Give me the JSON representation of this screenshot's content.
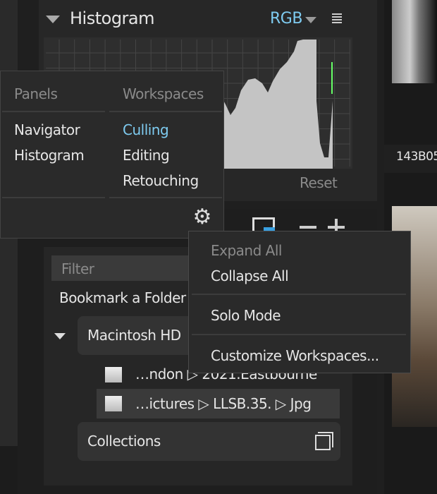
{
  "histogram": {
    "title": "Histogram",
    "channel": "RGB",
    "reset_label": "Reset",
    "icons": {
      "collapse": "triangle-down-icon",
      "dropdown": "caret-down-icon",
      "menu": "hamburger-icon"
    }
  },
  "panels_popup": {
    "panels_header": "Panels",
    "workspaces_header": "Workspaces",
    "panels": [
      {
        "label": "Navigator"
      },
      {
        "label": "Histogram"
      }
    ],
    "workspaces": [
      {
        "label": "Culling",
        "active": true
      },
      {
        "label": "Editing"
      },
      {
        "label": "Retouching"
      }
    ],
    "settings_icon": "gear-icon"
  },
  "folders": {
    "filter_placeholder": "Filter",
    "bookmark_label": "Bookmark a Folder",
    "drive_label": "Macintosh HD",
    "items": [
      {
        "label": "…ndon ▷ 2021.Eastbourne"
      },
      {
        "label": "…ictures ▷ LLSB.35. ▷ Jpg",
        "selected": true
      }
    ],
    "collections_label": "Collections"
  },
  "context_menu": {
    "items": [
      {
        "label": "Expand All",
        "disabled": true
      },
      {
        "label": "Collapse All"
      },
      {
        "label": "Solo Mode"
      },
      {
        "label": "Customize Workspaces..."
      }
    ]
  },
  "filmstrip": {
    "thumb_label": "143B05"
  },
  "colors": {
    "accent": "#7ecbf0",
    "folder_badge": "#3aa0e0"
  }
}
